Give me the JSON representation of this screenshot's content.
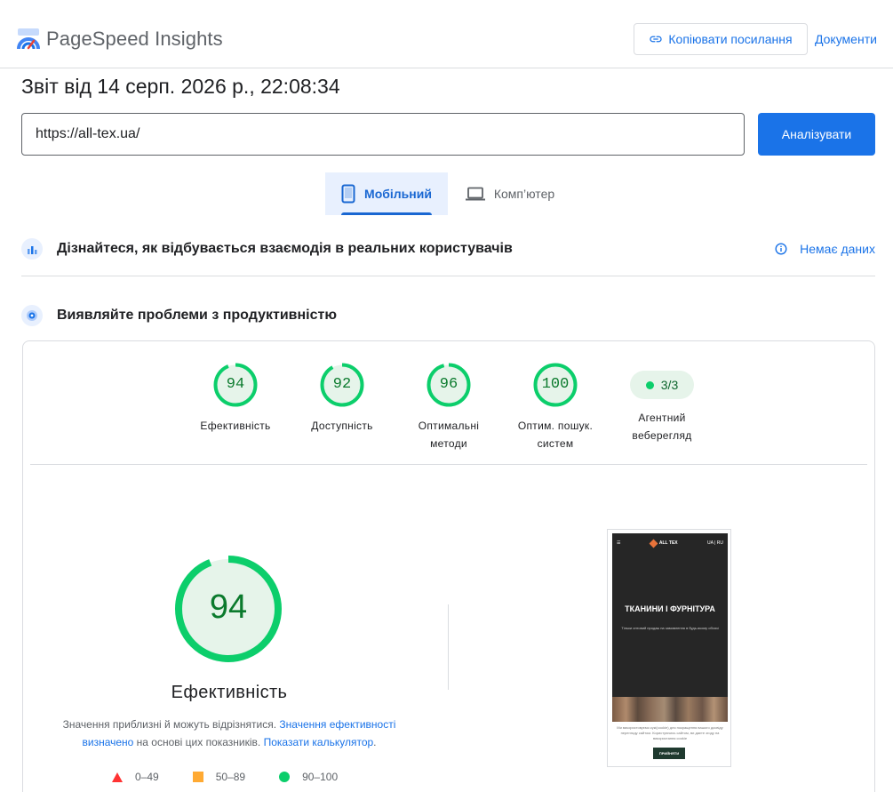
{
  "header": {
    "brand": "PageSpeed Insights",
    "copy_link_label": "Копіювати посилання",
    "docs_label": "Документи"
  },
  "report": {
    "title": "Звіт від 14 серп. 2026 р., 22:08:34"
  },
  "url_bar": {
    "value": "https://all-tex.ua/",
    "analyze_label": "Аналізувати"
  },
  "device_tabs": {
    "mobile_label": "Мобільний",
    "desktop_label": "Комп’ютер",
    "selected": "mobile"
  },
  "sections": {
    "real_users_title": "Дізнайтеся, як відбувається взаємодія в реальних користувачів",
    "no_data_label": "Немає даних",
    "diagnose_title": "Виявляйте проблеми з продуктивністю"
  },
  "categories": [
    {
      "score": "94",
      "label": "Ефективність",
      "fraction": 0.94
    },
    {
      "score": "92",
      "label": "Доступність",
      "fraction": 0.92
    },
    {
      "score": "96",
      "label": "Оптимальні методи",
      "fraction": 0.96
    },
    {
      "score": "100",
      "label": "Оптим. пошук. систем",
      "fraction": 1.0
    }
  ],
  "agent": {
    "value": "3/3",
    "label": "Агентний веберегляд"
  },
  "performance": {
    "score": "94",
    "fraction": 0.94,
    "title": "Ефективність",
    "note_prefix": "Значення приблизні й можуть відрізнятися.",
    "note_link1": "Значення ефективності визначено",
    "note_middle": "на основі цих показників.",
    "note_link2": "Показати калькулятор",
    "note_suffix": "."
  },
  "legend": {
    "poor": "0–49",
    "average": "50–89",
    "good": "90–100"
  },
  "thumbnail": {
    "brand": "ALL TEX",
    "langs": "UA | RU",
    "hero": "ТКАНИНИ І ФУРНІТУРА",
    "subtitle": "Тільки оптовий продаж на замовлення в будь-якому обсязі",
    "cookie_text": "Ми використовуємо кукі(cookie) для покращення вашого досвіду перегляду сайтом. Користуючись сайтом, ви даєте згоду на використання cookie",
    "accept_label": "ПРИЙНЯТИ"
  },
  "colors": {
    "accent": "#1a73e8",
    "good": "#0cce6b",
    "good_text": "#0b7a2d",
    "average": "#ffaa33",
    "poor": "#ff3333"
  }
}
